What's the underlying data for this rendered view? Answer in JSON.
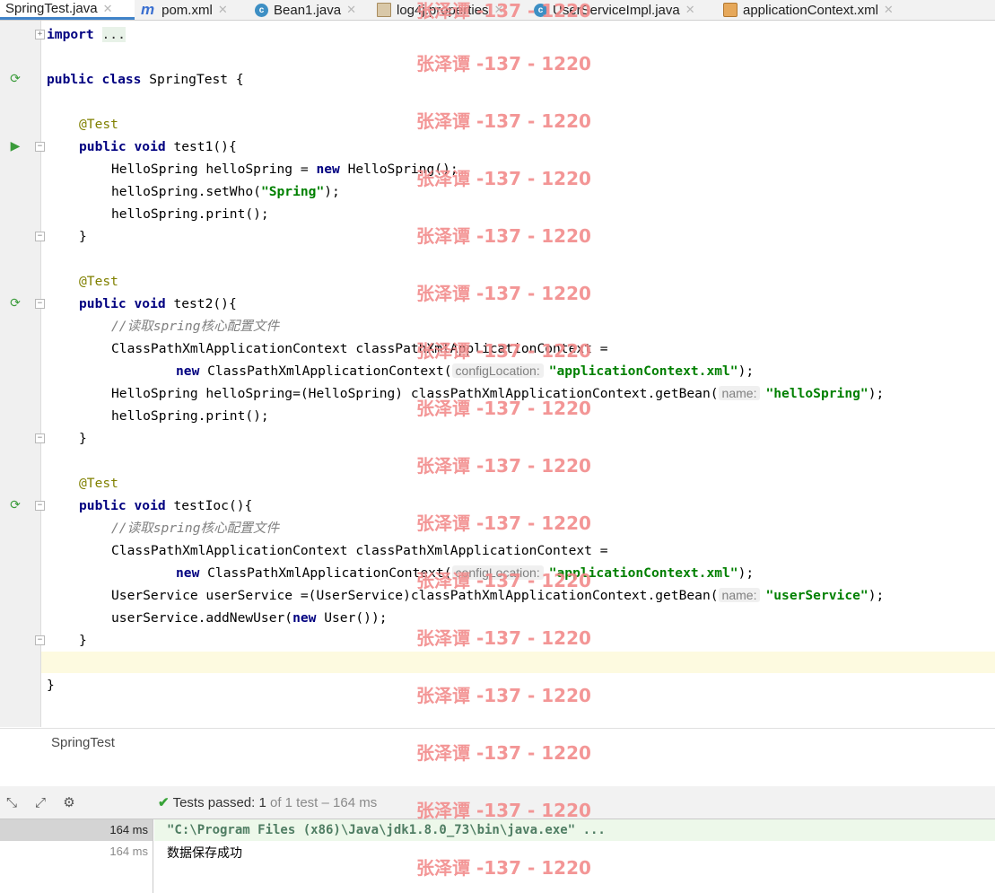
{
  "tabs": [
    {
      "label": "SpringTest.java",
      "icon": "java-class-icon",
      "active": true
    },
    {
      "label": "pom.xml",
      "icon": "maven-icon"
    },
    {
      "label": "Bean1.java",
      "icon": "class-icon"
    },
    {
      "label": "log4j.properties",
      "icon": "properties-file-icon"
    },
    {
      "label": "UserServiceImpl.java",
      "icon": "class-icon"
    },
    {
      "label": "applicationContext.xml",
      "icon": "xml-file-icon"
    }
  ],
  "code": {
    "import_kw": "import",
    "import_fold": "...",
    "l1_kw": "public class",
    "l1_rest": " SpringTest {",
    "ann": "@Test",
    "m_kw": "public void",
    "test1_sig": " test1(){",
    "t1_a": "HelloSpring helloSpring = ",
    "kw_new": "new",
    "t1_a2": " HelloSpring();",
    "t1_b1": "helloSpring.setWho(",
    "t1_b_str": "\"Spring\"",
    "t1_b2": ");",
    "t1_c": "helloSpring.print();",
    "close": "}",
    "test2_sig": " test2(){",
    "comment": "//读取spring核心配置文件",
    "ctx_decl": "ClassPathXmlApplicationContext classPathXmlApplicationContext =",
    "ctx_new_rest": " ClassPathXmlApplicationContext(",
    "hint_config": "configLocation:",
    "ctx_str": "\"applicationContext.xml\"",
    "end_paren": ");",
    "t2_get1": "HelloSpring helloSpring=(HelloSpring) classPathXmlApplicationContext.getBean(",
    "hint_name": "name:",
    "t2_get_str": "\"helloSpring\"",
    "t2_print": "helloSpring.print();",
    "testioc_sig": " testIoc(){",
    "t3_get1": "UserService userService =(UserService)classPathXmlApplicationContext.getBean(",
    "t3_get_str": "\"userService\"",
    "t3_add1": "userService.addNewUser(",
    "t3_add2": " User());"
  },
  "breadcrumb": "SpringTest",
  "run": {
    "status_prefix": "Tests passed: ",
    "status_count": "1",
    "status_suffix": " of 1 test – 164 ms",
    "tree_rows": [
      "164 ms",
      "164 ms"
    ],
    "console_cmd": "\"C:\\Program Files (x86)\\Java\\jdk1.8.0_73\\bin\\java.exe\" ...",
    "console_out": "数据保存成功"
  },
  "watermark": "张泽谭 -137 - 1220",
  "colors": {
    "keyword": "#000080",
    "string": "#008000",
    "annotation": "#808000",
    "comment": "#808080",
    "watermark": "#f28b8b"
  }
}
